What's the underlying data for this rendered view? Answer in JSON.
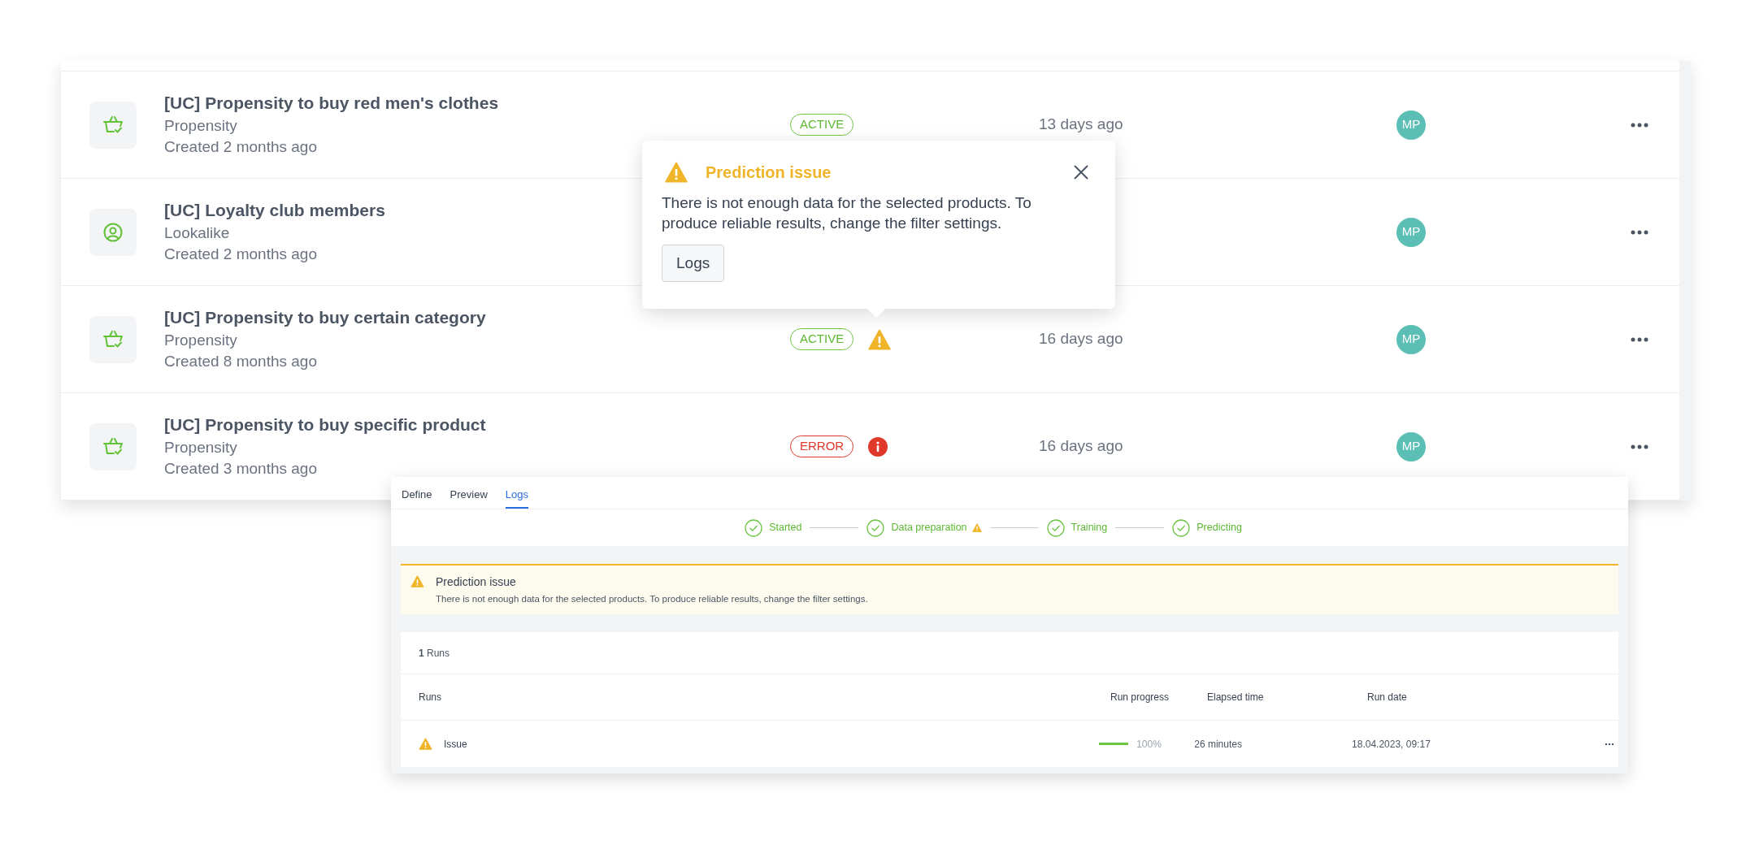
{
  "models": [
    {
      "kind": "basket",
      "title": "[UC] Propensity to buy red men's clothes",
      "type": "Propensity",
      "created": "Created 2 months ago",
      "status": {
        "label": "ACTIVE",
        "kind": "active"
      },
      "updated": "13 days ago",
      "owner": "MP"
    },
    {
      "kind": "user",
      "title": "[UC] Loyalty club members",
      "type": "Lookalike",
      "created": "Created 2 months ago",
      "owner": "MP"
    },
    {
      "kind": "basket",
      "title": "[UC] Propensity to buy certain category",
      "type": "Propensity",
      "created": "Created 8 months ago",
      "status": {
        "label": "ACTIVE",
        "kind": "active"
      },
      "issue": {
        "kind": "warning"
      },
      "updated": "16 days ago",
      "owner": "MP"
    },
    {
      "kind": "basket",
      "title": "[UC] Propensity to buy specific product",
      "type": "Propensity",
      "created": "Created 3 months ago",
      "status": {
        "label": "ERROR",
        "kind": "error"
      },
      "issue": {
        "kind": "error"
      },
      "updated": "16 days ago",
      "owner": "MP"
    }
  ],
  "popover": {
    "title": "Prediction issue",
    "body": "There is not enough data for the selected products. To produce reliable results, change the filter settings.",
    "button": "Logs"
  },
  "detail": {
    "tabs": [
      {
        "label": "Define",
        "selected": false
      },
      {
        "label": "Preview",
        "selected": false
      },
      {
        "label": "Logs",
        "selected": true
      }
    ],
    "steps": [
      {
        "label": "Started",
        "done": true,
        "warning": false
      },
      {
        "label": "Data preparation",
        "done": true,
        "warning": true
      },
      {
        "label": "Training",
        "done": true,
        "warning": false
      },
      {
        "label": "Predicting",
        "done": true,
        "warning": false
      }
    ],
    "alert": {
      "title": "Prediction issue",
      "body": "There is not enough data for the selected products. To produce reliable results, change the filter settings."
    },
    "runs_count": "**1** Runs",
    "columns": [
      "Runs",
      "Run progress",
      "Elapsed time",
      "Run date"
    ],
    "rows": [
      {
        "kind": "warning",
        "name": "Issue",
        "level": 1,
        "progress": "100%",
        "elapsed": "26 minutes",
        "date": "18.04.2023, 09:17"
      }
    ]
  }
}
